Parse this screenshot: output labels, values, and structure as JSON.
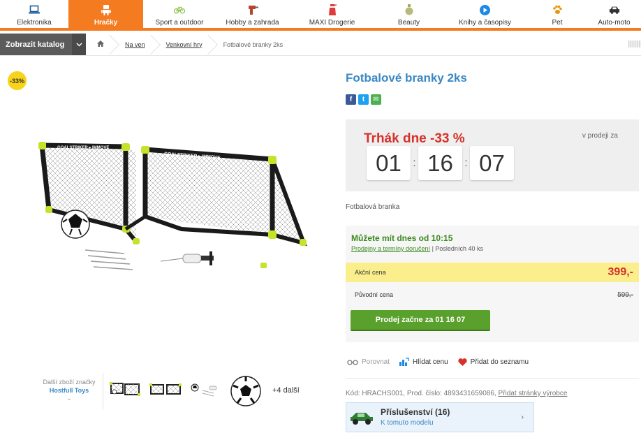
{
  "nav": {
    "categories": [
      {
        "label": "Elektronika",
        "icon": "laptop-icon"
      },
      {
        "label": "Hračky",
        "icon": "robot-icon",
        "active": true
      },
      {
        "label": "Sport a outdoor",
        "icon": "bicycle-icon"
      },
      {
        "label": "Hobby a zahrada",
        "icon": "drill-icon"
      },
      {
        "label": "MAXI Drogerie",
        "icon": "spray-bottle-icon"
      },
      {
        "label": "Beauty",
        "icon": "perfume-icon"
      },
      {
        "label": "Knihy a časopisy",
        "icon": "play-circle-icon"
      },
      {
        "label": "Pet",
        "icon": "paw-icon"
      },
      {
        "label": "Auto-moto",
        "icon": "car-icon"
      }
    ],
    "accent_color": "#f47b20"
  },
  "breadcrumb": {
    "catalog_button": "Zobrazit katalog",
    "items": [
      "Na ven",
      "Venkovní hry",
      "Fotbalové branky 2ks"
    ]
  },
  "product": {
    "title": "Fotbalové branky 2ks",
    "discount_badge": "-33%",
    "short_description": "Fotbalová branka",
    "brand_label": "Další zboží značky",
    "brand_name": "Hostfull Toys",
    "more_images": "+4 další"
  },
  "share": {
    "facebook": "f",
    "twitter": "t",
    "email": "✉"
  },
  "deal": {
    "title": "Trhák dne -33 %",
    "subtitle": "v prodeji za",
    "timer": {
      "hours": "01",
      "minutes": "16",
      "seconds": "07"
    }
  },
  "availability": {
    "headline": "Můžete mít dnes od 10:15",
    "link": "Prodejny a termíny doručení",
    "stock": "| Posledních 40 ks"
  },
  "pricing": {
    "action_label": "Akční cena",
    "action_price": "399,-",
    "original_label": "Původní cena",
    "original_price": "599,-",
    "cta": "Prodej začne za 01 16 07"
  },
  "actions": {
    "compare": "Porovnat",
    "watch_price": "Hlídat cenu",
    "add_to_list": "Přidat do seznamu"
  },
  "codes": {
    "text": "Kód: HRACHS001,  Prod. číslo: 4893431659086,",
    "link": "Přidat stránky výrobce"
  },
  "accessories": {
    "title": "Příslušenství (16)",
    "subtitle": "K tomuto modelu"
  }
}
